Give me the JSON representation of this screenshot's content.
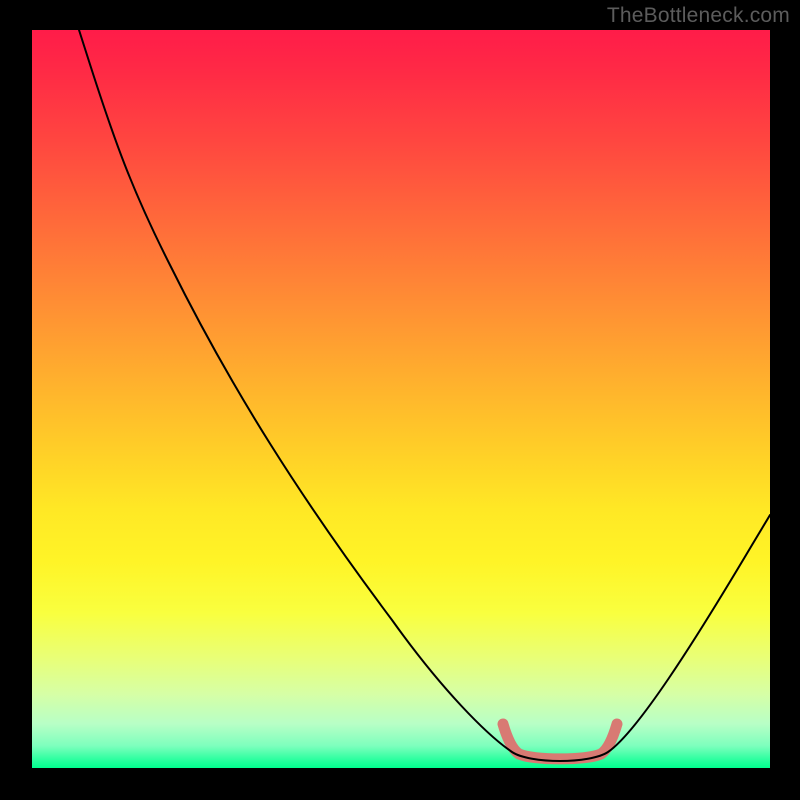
{
  "attribution": "TheBottleneck.com",
  "colors": {
    "background_black": "#000000",
    "attribution_text": "#5c5c5c",
    "curve_line": "#000000",
    "valley_accent": "#d87a73",
    "gradient_top": "#ff1c49",
    "gradient_bottom": "#00ff8e"
  },
  "chart_data": {
    "type": "line",
    "title": "",
    "xlabel": "",
    "ylabel": "",
    "x_range": [
      0,
      100
    ],
    "y_range": [
      0,
      100
    ],
    "grid": false,
    "legend_position": "none",
    "annotations": [
      "TheBottleneck.com"
    ],
    "background": "vertical-gradient red→orange→yellow→green",
    "series": [
      {
        "name": "bottleneck-curve",
        "color": "#000000",
        "x": [
          6,
          8,
          12,
          19,
          27,
          37,
          49,
          60,
          65,
          70,
          72,
          77,
          78,
          82,
          90,
          98,
          100
        ],
        "y": [
          100,
          97,
          85,
          68,
          51,
          36,
          20,
          8,
          4,
          2,
          1.5,
          1.5,
          2,
          4,
          16,
          30,
          34
        ]
      },
      {
        "name": "valley-accent",
        "color": "#d87a73",
        "x": [
          64,
          66,
          70,
          75,
          77,
          79
        ],
        "y": [
          6,
          2.5,
          1.2,
          1.2,
          2.5,
          6
        ]
      }
    ],
    "notes": "Axis units and labels are not shown in the original image; x/y expressed as percentages of the plot area (0 = left/bottom, 100 = right/top). The curve descends steeply from upper-left, reaches a flat minimum around x≈70–78, then rises toward the right edge. The flat bottom is overdrawn with a thick salmon/rose stroke."
  }
}
